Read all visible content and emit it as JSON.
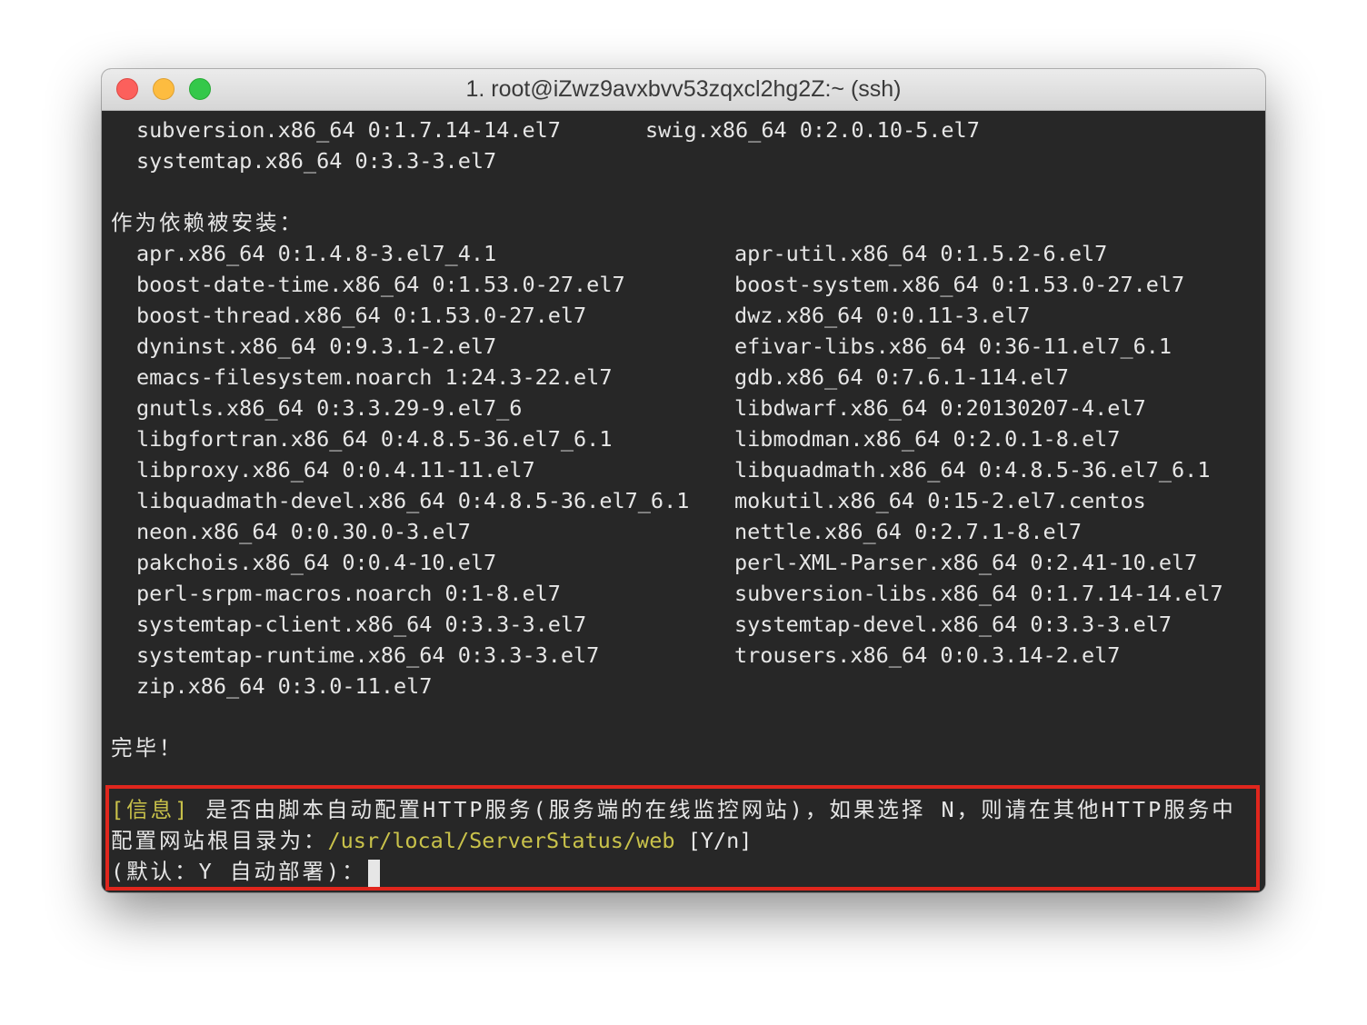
{
  "window": {
    "title": "1. root@iZwz9avxbvv53zqxcl2hg2Z:~ (ssh)"
  },
  "terminal": {
    "top_lines": [
      [
        "subversion.x86_64 0:1.7.14-14.el7",
        "swig.x86_64 0:2.0.10-5.el7"
      ],
      [
        "systemtap.x86_64 0:3.3-3.el7",
        ""
      ]
    ],
    "deps_heading": "作为依赖被安装：",
    "deps": [
      [
        "apr.x86_64 0:1.4.8-3.el7_4.1",
        "apr-util.x86_64 0:1.5.2-6.el7"
      ],
      [
        "boost-date-time.x86_64 0:1.53.0-27.el7",
        "boost-system.x86_64 0:1.53.0-27.el7"
      ],
      [
        "boost-thread.x86_64 0:1.53.0-27.el7",
        "dwz.x86_64 0:0.11-3.el7"
      ],
      [
        "dyninst.x86_64 0:9.3.1-2.el7",
        "efivar-libs.x86_64 0:36-11.el7_6.1"
      ],
      [
        "emacs-filesystem.noarch 1:24.3-22.el7",
        "gdb.x86_64 0:7.6.1-114.el7"
      ],
      [
        "gnutls.x86_64 0:3.3.29-9.el7_6",
        "libdwarf.x86_64 0:20130207-4.el7"
      ],
      [
        "libgfortran.x86_64 0:4.8.5-36.el7_6.1",
        "libmodman.x86_64 0:2.0.1-8.el7"
      ],
      [
        "libproxy.x86_64 0:0.4.11-11.el7",
        "libquadmath.x86_64 0:4.8.5-36.el7_6.1"
      ],
      [
        "libquadmath-devel.x86_64 0:4.8.5-36.el7_6.1",
        "mokutil.x86_64 0:15-2.el7.centos"
      ],
      [
        "neon.x86_64 0:0.30.0-3.el7",
        "nettle.x86_64 0:2.7.1-8.el7"
      ],
      [
        "pakchois.x86_64 0:0.4-10.el7",
        "perl-XML-Parser.x86_64 0:2.41-10.el7"
      ],
      [
        "perl-srpm-macros.noarch 0:1-8.el7",
        "subversion-libs.x86_64 0:1.7.14-14.el7"
      ],
      [
        "systemtap-client.x86_64 0:3.3-3.el7",
        "systemtap-devel.x86_64 0:3.3-3.el7"
      ],
      [
        "systemtap-runtime.x86_64 0:3.3-3.el7",
        "trousers.x86_64 0:0.3.14-2.el7"
      ],
      [
        "zip.x86_64 0:3.0-11.el7",
        ""
      ]
    ],
    "done": "完毕！",
    "prompt": {
      "tag": "[信息]",
      "line1_text": " 是否由脚本自动配置HTTP服务(服务端的在线监控网站)，如果选择 N，则请在其他HTTP服务中",
      "line2_prefix": "配置网站根目录为：",
      "path": "/usr/local/ServerStatus/web",
      "line2_suffix": " [Y/n]",
      "line3": "(默认：Y 自动部署)："
    }
  },
  "colors": {
    "terminal_bg": "#272727",
    "text": "#e6e6e6",
    "accent_yellow": "#c9c24a",
    "highlight_border": "#e0261d"
  }
}
